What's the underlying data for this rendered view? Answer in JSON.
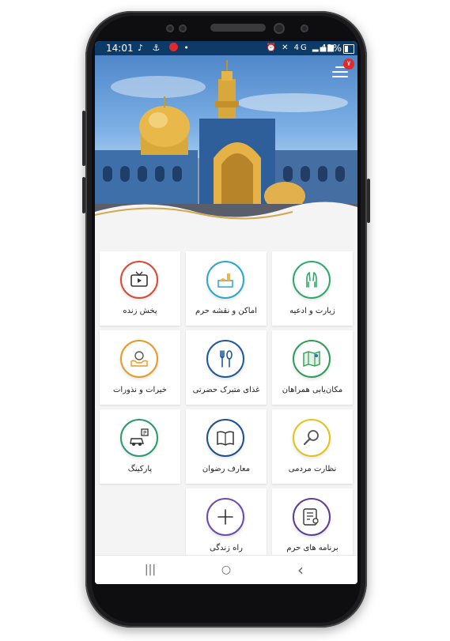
{
  "status_bar": {
    "time": "14:01",
    "left_icons": [
      "music-icon",
      "anchor-icon",
      "alert-icon",
      "dot-icon"
    ],
    "right_icons": [
      "alarm-icon",
      "mute-icon",
      "4g-icon",
      "signal-icon"
    ],
    "network": "4G",
    "battery_percent": "42%"
  },
  "header": {
    "menu_badge": "۷"
  },
  "tiles": [
    {
      "label": "زیارت و ادعیه",
      "icon": "praying-hands-icon",
      "color": "#2fa86a"
    },
    {
      "label": "اماکن و نقشه حرم",
      "icon": "shrine-map-icon",
      "color": "#2aa9c9"
    },
    {
      "label": "پخش زنده",
      "icon": "tv-icon",
      "color": "#d94a35"
    },
    {
      "label": "مکان‌یابی همراهان",
      "icon": "map-icon",
      "color": "#2e9d55"
    },
    {
      "label": "غذای متبرک حضرتی",
      "icon": "fork-spoon-icon",
      "color": "#1f5a9c"
    },
    {
      "label": "خیرات و نذورات",
      "icon": "charity-icon",
      "color": "#e89a25"
    },
    {
      "label": "نظارت مردمی",
      "icon": "magnifier-icon",
      "color": "#e3c21c"
    },
    {
      "label": "معارف رضوان",
      "icon": "book-icon",
      "color": "#1f4f8f"
    },
    {
      "label": "پارکینگ",
      "icon": "parking-car-icon",
      "color": "#2a9a6e"
    },
    {
      "label": "برنامه های حرم",
      "icon": "list-search-icon",
      "color": "#5a3e96"
    },
    {
      "label": "راه‌ زندگی",
      "icon": "plus-icon",
      "color": "#6a4bb0"
    }
  ],
  "nav": {
    "recent": "|||",
    "home": "○",
    "back": "‹"
  }
}
